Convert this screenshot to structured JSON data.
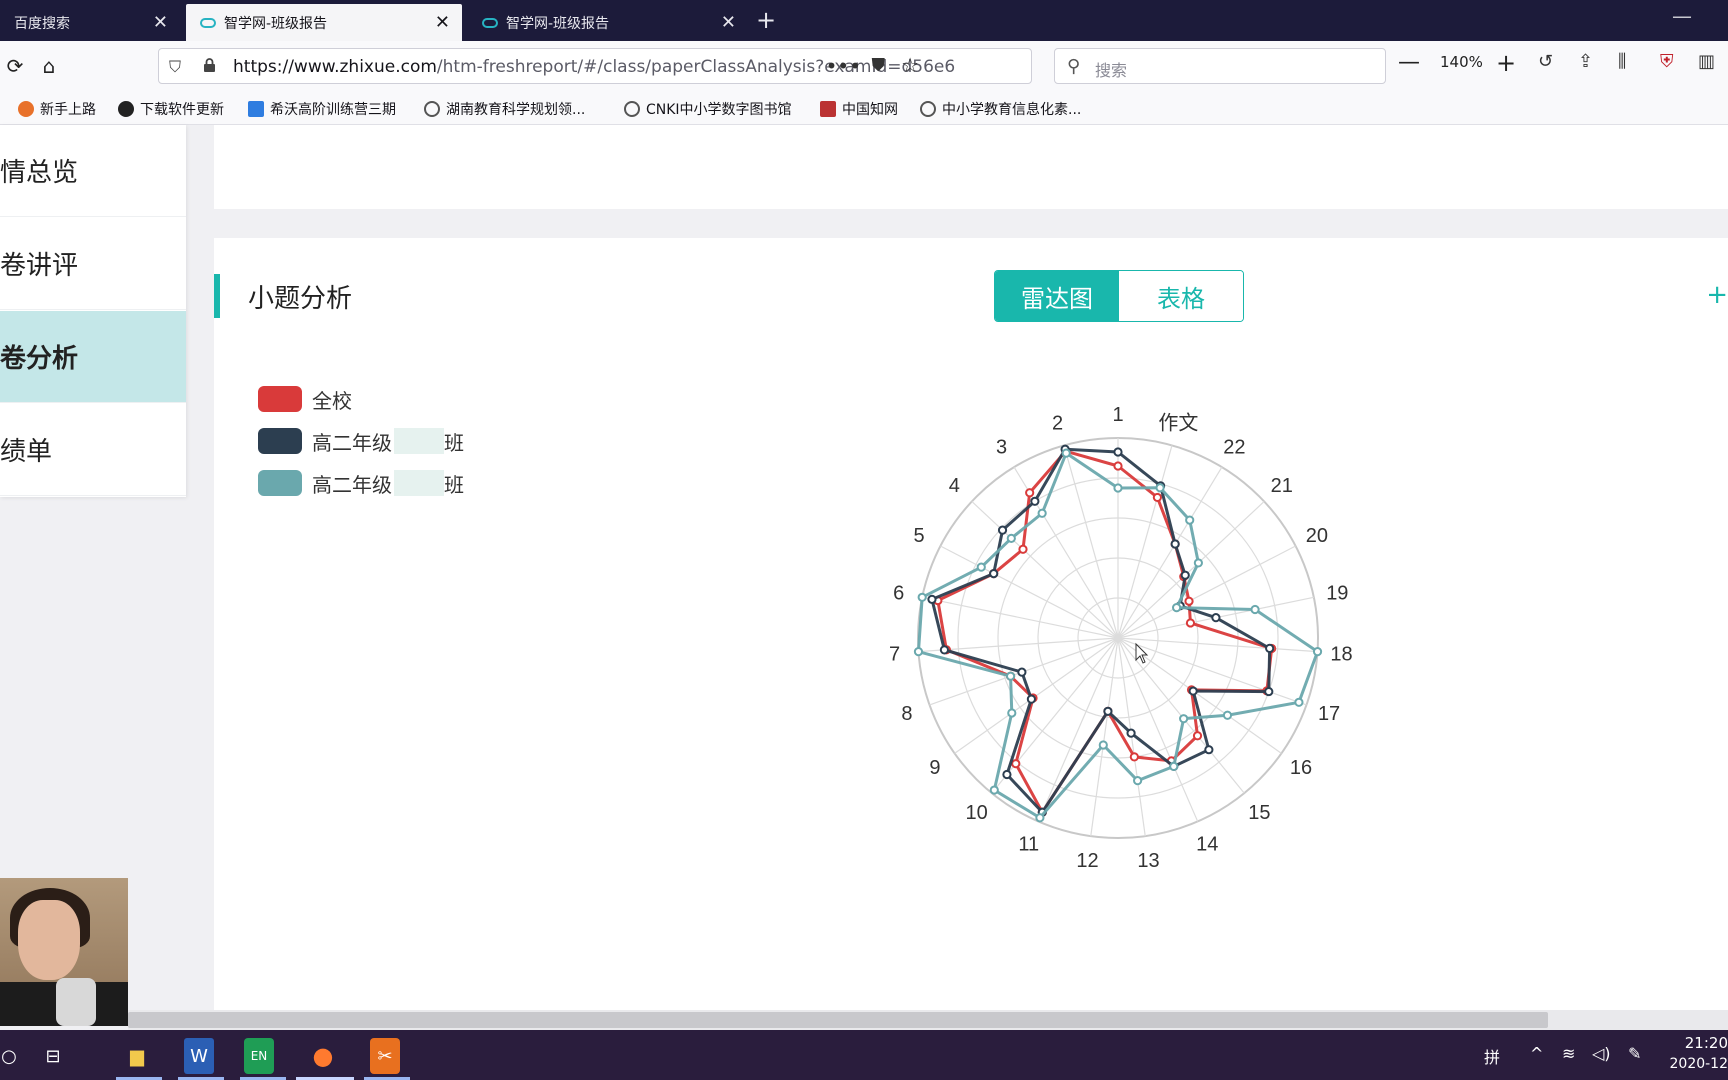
{
  "browser": {
    "tabs": [
      {
        "title": "百度搜索"
      },
      {
        "title": "智学网-班级报告"
      },
      {
        "title": "智学网-班级报告"
      }
    ],
    "new_tab": "+",
    "close_glyph": "✕",
    "url_host": "https://www.zhixue.com",
    "url_path": "/htm-freshreport/#/class/paperClassAnalysis?examId=d56e6",
    "search_placeholder": "搜索",
    "zoom_level": "140%",
    "bookmarks": [
      {
        "label": "新手上路",
        "icon": "firefox-icon"
      },
      {
        "label": "下载软件更新",
        "icon": "github-icon"
      },
      {
        "label": "希沃高阶训练营三期",
        "icon": "seewo-icon"
      },
      {
        "label": "湖南教育科学规划领...",
        "icon": "globe-icon"
      },
      {
        "label": "CNKI中小学数字图书馆",
        "icon": "globe-icon"
      },
      {
        "label": "中国知网",
        "icon": "cnki-icon"
      },
      {
        "label": "中小学教育信息化素...",
        "icon": "globe-icon"
      }
    ]
  },
  "sidebar": {
    "items": [
      {
        "label": "情总览",
        "active": false
      },
      {
        "label": "卷讲评",
        "active": false
      },
      {
        "label": "卷分析",
        "active": true
      },
      {
        "label": "绩单",
        "active": false
      }
    ]
  },
  "section": {
    "title": "小题分析",
    "toggle": {
      "radar": "雷达图",
      "table": "表格"
    },
    "edge_glyph": "+"
  },
  "colors": {
    "accent": "#19b7ac",
    "school": "#d93a3a",
    "class_a": "#2c3e50",
    "class_b": "#6aa8ad"
  },
  "legend": [
    {
      "label": "全校",
      "suffix": "",
      "color": "#d93a3a"
    },
    {
      "label": "高二年级",
      "suffix": "班",
      "color": "#2c3e50"
    },
    {
      "label": "高二年级",
      "suffix": "班",
      "color": "#6aa8ad"
    }
  ],
  "chart_data": {
    "type": "radar",
    "categories": [
      "1",
      "作文",
      "22",
      "21",
      "20",
      "19",
      "18",
      "17",
      "16",
      "15",
      "14",
      "13",
      "12",
      "11",
      "10",
      "9",
      "8",
      "7",
      "6",
      "5",
      "4",
      "3",
      "2"
    ],
    "rmax": 1.0,
    "rings": 5,
    "series": [
      {
        "name": "全校",
        "color": "#d93a3a",
        "values": [
          0.86,
          0.73,
          0.55,
          0.45,
          0.4,
          0.37,
          0.77,
          0.79,
          0.45,
          0.63,
          0.67,
          0.6,
          0.37,
          0.95,
          0.81,
          0.52,
          0.57,
          0.86,
          0.92,
          0.7,
          0.65,
          0.85,
          0.97
        ]
      },
      {
        "name": "高二年级班",
        "color": "#2c3e50",
        "values": [
          0.93,
          0.79,
          0.55,
          0.46,
          0.35,
          0.5,
          0.76,
          0.8,
          0.46,
          0.72,
          0.7,
          0.48,
          0.37,
          0.95,
          0.88,
          0.53,
          0.51,
          0.87,
          0.95,
          0.7,
          0.79,
          0.8,
          0.98
        ]
      },
      {
        "name": "高二年级班",
        "color": "#6aa8ad",
        "values": [
          0.75,
          0.78,
          0.69,
          0.55,
          0.33,
          0.7,
          1.0,
          0.96,
          0.67,
          0.52,
          0.7,
          0.72,
          0.54,
          0.98,
          0.98,
          0.65,
          0.57,
          1.0,
          1.0,
          0.77,
          0.73,
          0.73,
          0.96
        ]
      }
    ]
  },
  "taskbar": {
    "im_label": "拼",
    "time": "21:20",
    "date": "2020-12"
  }
}
